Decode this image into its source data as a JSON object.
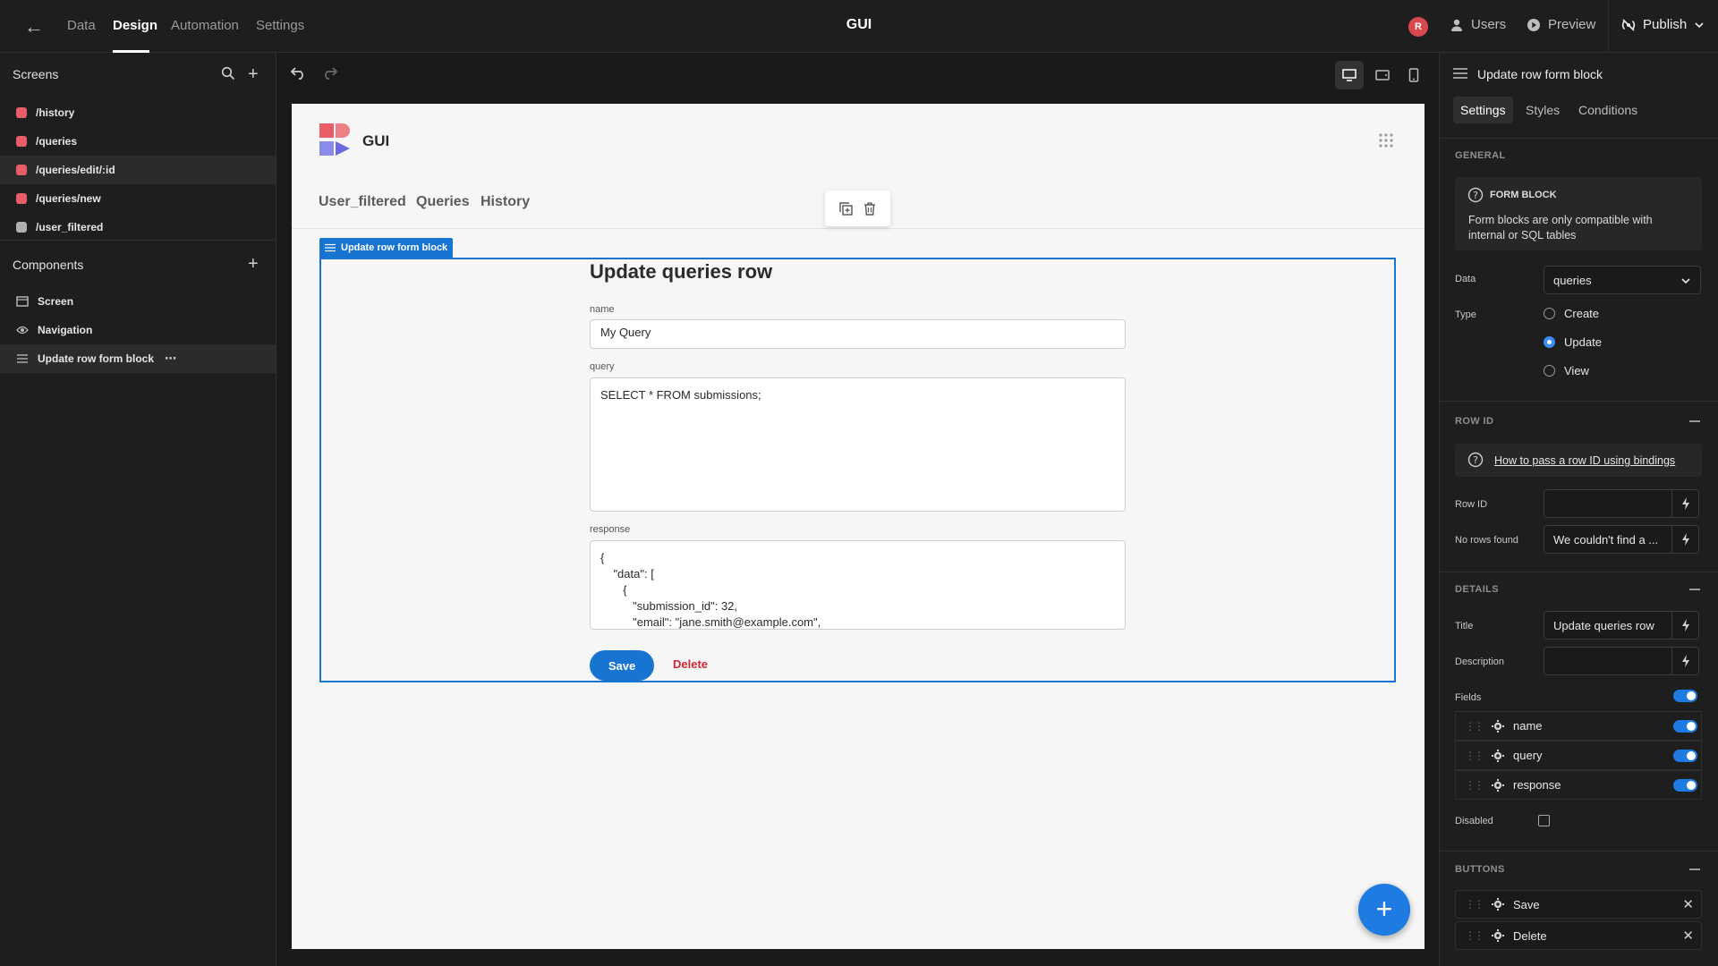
{
  "topbar": {
    "tabs": [
      "Data",
      "Design",
      "Automation",
      "Settings"
    ],
    "app_title": "GUI",
    "avatar_initial": "R",
    "users_label": "Users",
    "preview_label": "Preview",
    "publish_label": "Publish"
  },
  "left": {
    "screens_title": "Screens",
    "screens": [
      {
        "route": "/history",
        "color": "#e85d66"
      },
      {
        "route": "/queries",
        "color": "#e85d66"
      },
      {
        "route": "/queries/edit/:id",
        "color": "#e85d66"
      },
      {
        "route": "/queries/new",
        "color": "#e85d66"
      },
      {
        "route": "/user_filtered",
        "color": "#b0b0b0"
      }
    ],
    "components_title": "Components",
    "components": [
      "Screen",
      "Navigation",
      "Update row form block"
    ]
  },
  "canvas": {
    "app_title": "GUI",
    "nav": [
      "User_filtered",
      "Queries",
      "History"
    ],
    "block_tag": "Update row form block",
    "form_title": "Update queries row",
    "fields": [
      {
        "label": "name",
        "value": "My Query"
      },
      {
        "label": "query",
        "value": "SELECT * FROM submissions;"
      },
      {
        "label": "response",
        "value": "{\n    \"data\": [\n       {\n          \"submission_id\": 32,\n          \"email\": \"jane.smith@example.com\","
      }
    ],
    "save_label": "Save",
    "delete_label": "Delete",
    "fab_label": "+"
  },
  "right": {
    "header_title": "Update row form block",
    "tabs": [
      "Settings",
      "Styles",
      "Conditions"
    ],
    "general_title": "GENERAL",
    "info_title": "FORM BLOCK",
    "info_text": "Form blocks are only compatible with internal or SQL tables",
    "data_label": "Data",
    "data_value": "queries",
    "type_label": "Type",
    "type_options": [
      "Create",
      "Update",
      "View"
    ],
    "type_selected": "Update",
    "row_id_title": "ROW ID",
    "row_id_help": "How to pass a row ID using bindings",
    "row_id_label": "Row ID",
    "row_id_value": "",
    "no_rows_label": "No rows found",
    "no_rows_value": "We couldn't find a ...",
    "details_title": "DETAILS",
    "title_label": "Title",
    "title_value": "Update queries row",
    "description_label": "Description",
    "description_value": "",
    "fields_label": "Fields",
    "fields": [
      "name",
      "query",
      "response"
    ],
    "disabled_label": "Disabled",
    "buttons_title": "BUTTONS",
    "buttons": [
      "Save",
      "Delete"
    ]
  },
  "colors": {
    "accent": "#1775d1",
    "danger": "#cf2a3a",
    "screen_red": "#e85d66"
  }
}
